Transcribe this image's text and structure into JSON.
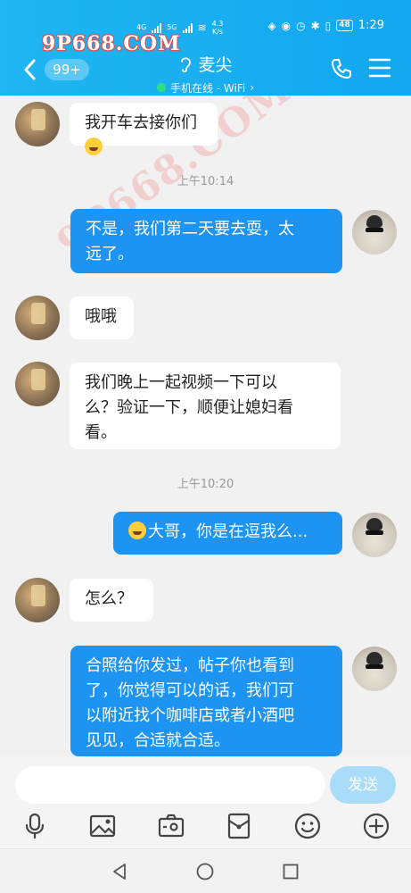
{
  "statusbar": {
    "speed_value": "4.3",
    "speed_unit": "K/s",
    "battery": "48",
    "time": "1:29",
    "net_left": "4G",
    "net_right": "5G"
  },
  "watermark": "9P668.COM",
  "header": {
    "unread_badge": "99+",
    "contact_name": "麦尖",
    "status_text": "手机在线 - WiFi",
    "status_chevron": "›"
  },
  "messages": [
    {
      "side": "left",
      "text": "我开车去接你们",
      "emoji_after": "grinning-emoji"
    },
    {
      "type": "time",
      "text": "上午10:14"
    },
    {
      "side": "right",
      "line1": "不是，我们第二天要去耍，太",
      "line2": "远了。"
    },
    {
      "side": "left",
      "text": "哦哦"
    },
    {
      "side": "left",
      "line1": "我们晚上一起视频一下可以",
      "line2": "么？验证一下，顺便让媳妇看",
      "line3": "看。"
    },
    {
      "type": "time",
      "text": "上午10:20"
    },
    {
      "side": "right",
      "text": "大哥，你是在逗我么...",
      "emoji_before": "laughing-emoji"
    },
    {
      "side": "left",
      "text": "怎么？"
    },
    {
      "side": "right",
      "line1": "合照给你发过，帖子你也看到",
      "line2": "了，你觉得可以的话，我们可",
      "line3": "以附近找个咖啡店或者小酒吧",
      "line4": "见见，合适就合适。"
    }
  ],
  "composer": {
    "input_value": "",
    "send_label": "发送"
  },
  "toolbar_icons": [
    "microphone-icon",
    "image-icon",
    "camera-icon",
    "red-packet-icon",
    "emoji-icon",
    "plus-icon"
  ],
  "navbar_icons": [
    "back-triangle-icon",
    "home-circle-icon",
    "recents-square-icon"
  ],
  "colors": {
    "header": "#1fb6f2",
    "bubble_right": "#1d93f2",
    "bubble_left": "#ffffff",
    "send_button": "#a9dcf8"
  }
}
